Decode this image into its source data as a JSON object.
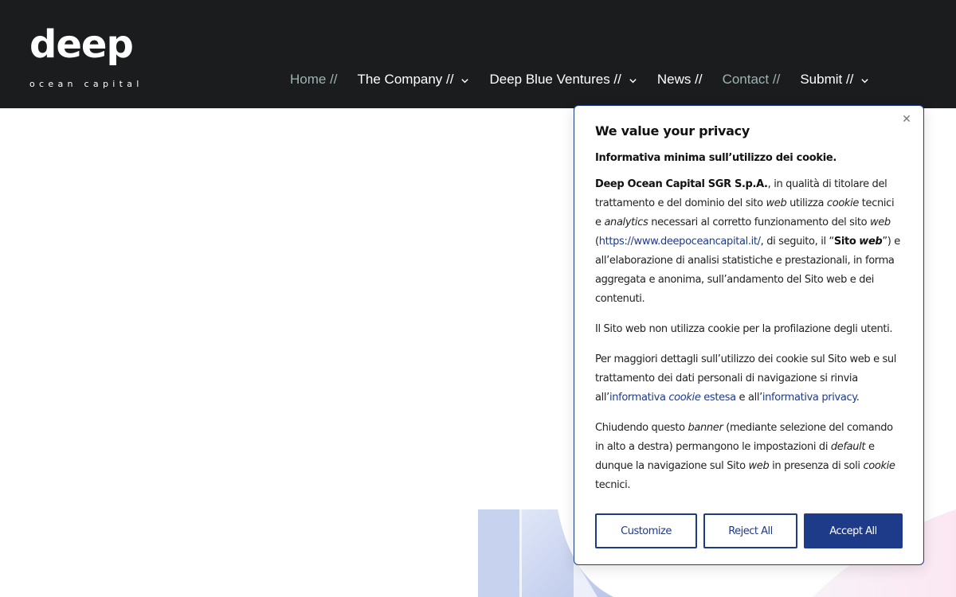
{
  "header": {
    "logo": {
      "word": "deep",
      "sub": "ocean capital"
    },
    "nav": [
      {
        "label": "Home //",
        "dropdown": false,
        "muted": true
      },
      {
        "label": "The Company //",
        "dropdown": true,
        "muted": false
      },
      {
        "label": "Deep Blue Ventures //",
        "dropdown": true,
        "muted": false
      },
      {
        "label": "News //",
        "dropdown": false,
        "muted": false
      },
      {
        "label": "Contact //",
        "dropdown": false,
        "muted": true
      },
      {
        "label": "Submit //",
        "dropdown": true,
        "muted": false
      }
    ]
  },
  "cookie": {
    "close_icon": "close-icon",
    "title": "We value your privacy",
    "subtitle": "Informativa minima sull’utilizzo dei cookie.",
    "p1": {
      "company": "Deep Ocean Capital SGR S.p.A.",
      "t1": ", in qualità di titolare del trattamento e del dominio del sito ",
      "web1": "web",
      "t2": " utilizza ",
      "cookie1": "cookie",
      "t3": " tecnici e ",
      "analytics": "analytics",
      "t4": " necessari al corretto funzionamento del sito ",
      "web2": "web",
      "t5": " (",
      "link": "https://www.deepoceancapital.it/",
      "t6": ", di seguito, il “",
      "sito_web": "Sito",
      "sito_web_i": "web",
      "t7": "”) e all’elaborazione di analisi statistiche e prestazionali, in forma aggregata e anonima, sull’andamento del Sito web e dei contenuti."
    },
    "p2": "Il Sito web non utilizza cookie per la profilazione degli utenti.",
    "p3": {
      "t1": "Per maggiori dettagli sull’utilizzo dei cookie sul Sito web e sul trattamento dei dati personali di navigazione si rinvia all’",
      "link1_a": "informativa ",
      "link1_b": "cookie",
      "link1_c": " estesa",
      "t2": " e all’",
      "link2": "informativa privacy",
      "t3": "."
    },
    "p4": {
      "t1": "Chiudendo questo ",
      "banner": "banner",
      "t2": " (mediante selezione del comando in alto a destra) permangono le impostazioni di ",
      "default": "default",
      "t3": " e dunque la navigazione sul Sito ",
      "web": "web",
      "t4": " in presenza di soli ",
      "cookie": "cookie",
      "t5": " tecnici."
    },
    "buttons": {
      "customize": "Customize",
      "reject": "Reject All",
      "accept": "Accept All"
    }
  },
  "colors": {
    "header_bg": "#1a1c1e",
    "accent": "#1e3b8a",
    "nav_muted": "#9fb3b0"
  }
}
